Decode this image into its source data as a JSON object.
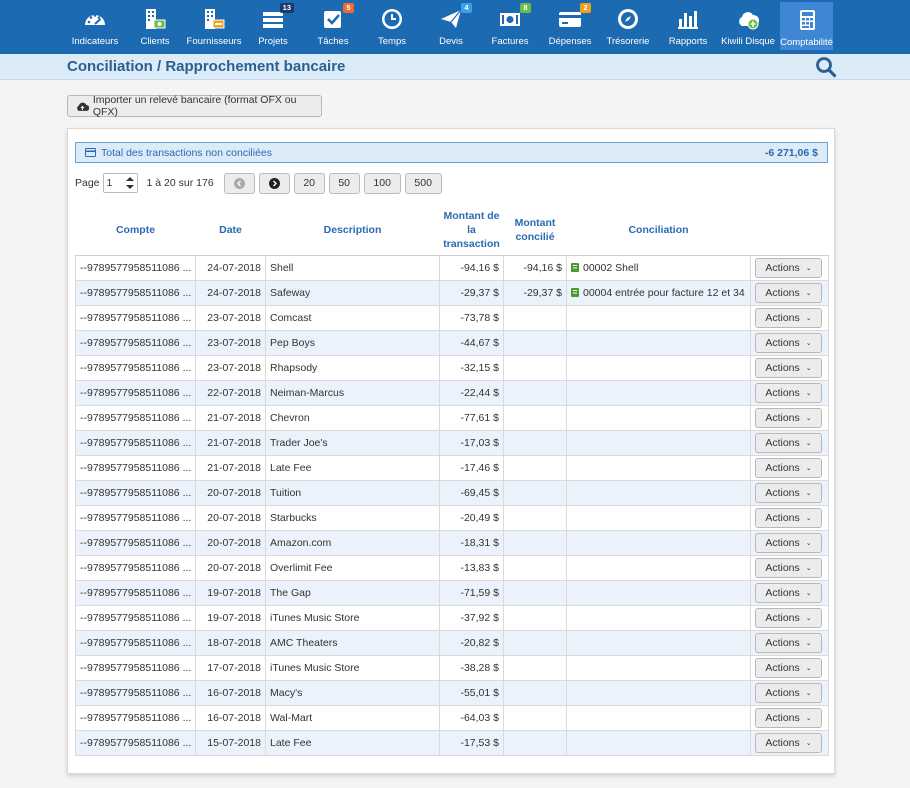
{
  "nav": [
    {
      "label": "Indicateurs",
      "icon": "dashboard-icon",
      "badge": ""
    },
    {
      "label": "Clients",
      "icon": "clients-icon",
      "badge": ""
    },
    {
      "label": "Fournisseurs",
      "icon": "suppliers-icon",
      "badge": ""
    },
    {
      "label": "Projets",
      "icon": "projects-icon",
      "badge": "13"
    },
    {
      "label": "Tâches",
      "icon": "tasks-icon",
      "badge": "5"
    },
    {
      "label": "Temps",
      "icon": "clock-icon",
      "badge": ""
    },
    {
      "label": "Devis",
      "icon": "paper-plane-icon",
      "badge": "4"
    },
    {
      "label": "Factures",
      "icon": "invoice-icon",
      "badge": "8"
    },
    {
      "label": "Dépenses",
      "icon": "credit-card-icon",
      "badge": "2"
    },
    {
      "label": "Trésorerie",
      "icon": "compass-icon",
      "badge": ""
    },
    {
      "label": "Rapports",
      "icon": "bar-chart-icon",
      "badge": ""
    },
    {
      "label": "Kiwili Disque",
      "icon": "cloud-drive-icon",
      "badge": ""
    },
    {
      "label": "Comptabilité",
      "icon": "calculator-icon",
      "badge": ""
    }
  ],
  "colors": {
    "nav_bg": "#1c6ab1",
    "nav_active": "#3f86d4",
    "badge_dark": "#1b3a6b",
    "badge_orange": "#f06a2e",
    "badge_blue": "#3aa0e8",
    "badge_green": "#6cbd45",
    "badge_amber": "#f0a020",
    "accent_text": "#2a6ab2"
  },
  "page": {
    "title": "Conciliation / Rapprochement bancaire"
  },
  "import_button": "Importer un relevé bancaire (format OFX ou QFX)",
  "total": {
    "label": "Total des transactions non conciliées",
    "value": "-6 271,06 $"
  },
  "pager": {
    "label": "Page",
    "page_value": "1",
    "info": "1 à 20 sur 176",
    "sizes": [
      "20",
      "50",
      "100",
      "500"
    ]
  },
  "columns": {
    "compte": "Compte",
    "date": "Date",
    "description": "Description",
    "montant_transaction": "Montant de la transaction",
    "montant_concilie": "Montant concilié",
    "conciliation": "Conciliation"
  },
  "actions_label": "Actions",
  "rows": [
    {
      "compte": "--9789577958511086 ...",
      "date": "24-07-2018",
      "description": "Shell",
      "montant": "-94,16 $",
      "concilie": "-94,16 $",
      "conciliation": "00002 Shell"
    },
    {
      "compte": "--9789577958511086 ...",
      "date": "24-07-2018",
      "description": "Safeway",
      "montant": "-29,37 $",
      "concilie": "-29,37 $",
      "conciliation": "00004 entrée pour facture 12 et 34"
    },
    {
      "compte": "--9789577958511086 ...",
      "date": "23-07-2018",
      "description": "Comcast",
      "montant": "-73,78 $",
      "concilie": "",
      "conciliation": ""
    },
    {
      "compte": "--9789577958511086 ...",
      "date": "23-07-2018",
      "description": "Pep Boys",
      "montant": "-44,67 $",
      "concilie": "",
      "conciliation": ""
    },
    {
      "compte": "--9789577958511086 ...",
      "date": "23-07-2018",
      "description": "Rhapsody",
      "montant": "-32,15 $",
      "concilie": "",
      "conciliation": ""
    },
    {
      "compte": "--9789577958511086 ...",
      "date": "22-07-2018",
      "description": "Neiman-Marcus",
      "montant": "-22,44 $",
      "concilie": "",
      "conciliation": ""
    },
    {
      "compte": "--9789577958511086 ...",
      "date": "21-07-2018",
      "description": "Chevron",
      "montant": "-77,61 $",
      "concilie": "",
      "conciliation": ""
    },
    {
      "compte": "--9789577958511086 ...",
      "date": "21-07-2018",
      "description": "Trader Joe's",
      "montant": "-17,03 $",
      "concilie": "",
      "conciliation": ""
    },
    {
      "compte": "--9789577958511086 ...",
      "date": "21-07-2018",
      "description": "Late Fee",
      "montant": "-17,46 $",
      "concilie": "",
      "conciliation": ""
    },
    {
      "compte": "--9789577958511086 ...",
      "date": "20-07-2018",
      "description": "Tuition",
      "montant": "-69,45 $",
      "concilie": "",
      "conciliation": ""
    },
    {
      "compte": "--9789577958511086 ...",
      "date": "20-07-2018",
      "description": "Starbucks",
      "montant": "-20,49 $",
      "concilie": "",
      "conciliation": ""
    },
    {
      "compte": "--9789577958511086 ...",
      "date": "20-07-2018",
      "description": "Amazon.com",
      "montant": "-18,31 $",
      "concilie": "",
      "conciliation": ""
    },
    {
      "compte": "--9789577958511086 ...",
      "date": "20-07-2018",
      "description": "Overlimit Fee",
      "montant": "-13,83 $",
      "concilie": "",
      "conciliation": ""
    },
    {
      "compte": "--9789577958511086 ...",
      "date": "19-07-2018",
      "description": "The Gap",
      "montant": "-71,59 $",
      "concilie": "",
      "conciliation": ""
    },
    {
      "compte": "--9789577958511086 ...",
      "date": "19-07-2018",
      "description": "iTunes Music Store",
      "montant": "-37,92 $",
      "concilie": "",
      "conciliation": ""
    },
    {
      "compte": "--9789577958511086 ...",
      "date": "18-07-2018",
      "description": "AMC Theaters",
      "montant": "-20,82 $",
      "concilie": "",
      "conciliation": ""
    },
    {
      "compte": "--9789577958511086 ...",
      "date": "17-07-2018",
      "description": "iTunes Music Store",
      "montant": "-38,28 $",
      "concilie": "",
      "conciliation": ""
    },
    {
      "compte": "--9789577958511086 ...",
      "date": "16-07-2018",
      "description": "Macy's",
      "montant": "-55,01 $",
      "concilie": "",
      "conciliation": ""
    },
    {
      "compte": "--9789577958511086 ...",
      "date": "16-07-2018",
      "description": "Wal-Mart",
      "montant": "-64,03 $",
      "concilie": "",
      "conciliation": ""
    },
    {
      "compte": "--9789577958511086 ...",
      "date": "15-07-2018",
      "description": "Late Fee",
      "montant": "-17,53 $",
      "concilie": "",
      "conciliation": ""
    }
  ]
}
